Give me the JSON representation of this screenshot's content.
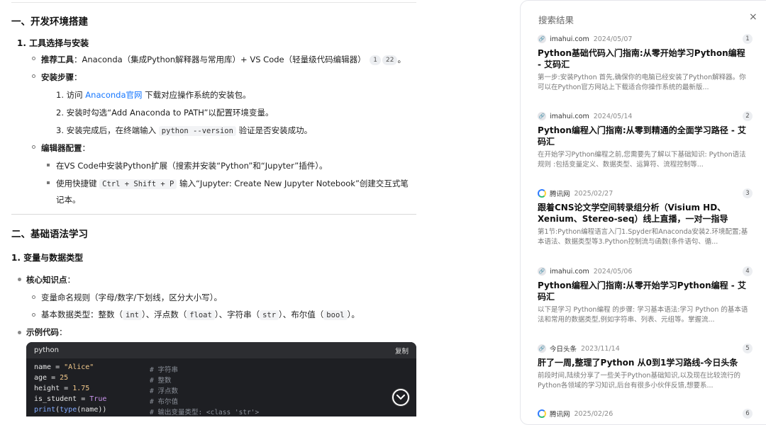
{
  "article": {
    "h1": "一、开发环境搭建",
    "s1_title": "1. 工具选择与安装",
    "tools_label": "推荐工具",
    "tools_text": "：Anaconda（集成Python解释器与常用库）+ VS Code（轻量级代码编辑器）",
    "tools_cites": [
      "1",
      "22"
    ],
    "tools_end": "。",
    "steps_label": "安装步骤",
    "steps_colon": "：",
    "step1_pre": "1. 访问 ",
    "step1_link": "Anaconda官网",
    "step1_post": " 下载对应操作系统的安装包。",
    "step2": "2. 安装时勾选“Add Anaconda to PATH”以配置环境变量。",
    "step3_pre": "3. 安装完成后，在终端输入 ",
    "step3_code": "python --version",
    "step3_post": " 验证是否安装成功。",
    "editor_label": "编辑器配置",
    "editor_colon": "：",
    "editor1": "在VS Code中安装Python扩展（搜索并安装“Python”和“Jupyter”插件）。",
    "editor2_pre": "使用快捷键 ",
    "editor2_code": "Ctrl + Shift + P",
    "editor2_post": " 输入“Jupyter: Create New Jupyter Notebook”创建交互式笔",
    "editor2_cont": "记本。",
    "h2": "二、基础语法学习",
    "s2_title": "1. 变量与数据类型",
    "core_label": "核心知识点",
    "core_colon": "：",
    "core1": "变量命名规则（字母/数字/下划线，区分大小写）。",
    "core2_parts": [
      "基本数据类型：整数（",
      "int",
      "）、浮点数（",
      "float",
      "）、字符串（",
      "str",
      "）、布尔值（",
      "bool",
      "）。"
    ],
    "example_label": "示例代码",
    "example_colon": "：",
    "code": {
      "lang": "python",
      "copy_label": "复制",
      "lines": [
        {
          "code": "name = \"Alice\"",
          "comment": "# 字符串"
        },
        {
          "code": "age = 25",
          "comment": "# 整数"
        },
        {
          "code": "height = 1.75",
          "comment": "# 浮点数"
        },
        {
          "code": "is_student = True",
          "comment": "# 布尔值"
        },
        {
          "code": "print(type(name))",
          "comment": "# 输出变量类型: <class 'str'>"
        }
      ]
    }
  },
  "panel": {
    "title": "搜索结果",
    "close": "×",
    "results": [
      {
        "site": "imahui.com",
        "date": "2024/05/07",
        "num": "1",
        "title": "Python基础代码入门指南:从零开始学习Python编程 - 艾码汇",
        "snippet": "第一步:安装Python 首先,确保你的电脑已经安装了Python解释器。你可以在Python官方网站上下载适合你操作系统的最新版..."
      },
      {
        "site": "imahui.com",
        "date": "2024/05/14",
        "num": "2",
        "title": "Python编程入门指南:从零到精通的全面学习路径 - 艾码汇",
        "snippet": "在开始学习Python编程之前,您需要先了解以下基础知识: Python语法规则 :包括变量定义、数据类型、运算符、流程控制等..."
      },
      {
        "site": "腾讯网",
        "date": "2025/02/27",
        "num": "3",
        "title": "跟着CNS论文学空间转录组分析（Visium HD、Xenium、Stereo-seq）线上直播，一对一指导",
        "snippet": "第1节:Python编程语言入门1.Spyder和Anaconda安装2.环境配置;基本语法、数据类型等3.Python控制流与函数(条件语句、循..."
      },
      {
        "site": "imahui.com",
        "date": "2024/05/06",
        "num": "4",
        "title": "Python编程入门指南:从零开始学习Python编程 - 艾码汇",
        "snippet": "以下是学习 Python编程 的步骤: 学习基本语法:学习 Python 的基本语法和常用的数据类型,例如字符串、列表、元组等。掌握流..."
      },
      {
        "site": "今日头条",
        "date": "2023/11/14",
        "num": "5",
        "title": "肝了一周,整理了Python 从0到1学习路线-今日头条",
        "snippet": "前段时间,陆续分享了一些关于Python基础知识,以及现在比较流行的Python各领域的学习知识,后台有很多小伙伴反馈,想要系..."
      },
      {
        "site": "腾讯网",
        "date": "2025/02/26",
        "num": "6",
        "title": "",
        "snippet": ""
      }
    ]
  }
}
